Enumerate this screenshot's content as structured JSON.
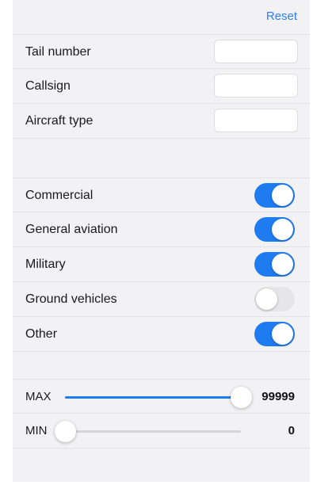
{
  "header": {
    "reset_label": "Reset"
  },
  "fields": [
    {
      "label": "Tail number",
      "value": "",
      "placeholder": ""
    },
    {
      "label": "Callsign",
      "value": "",
      "placeholder": ""
    },
    {
      "label": "Aircraft type",
      "value": "",
      "placeholder": ""
    }
  ],
  "categories": [
    {
      "label": "Commercial",
      "enabled": true
    },
    {
      "label": "General aviation",
      "enabled": true
    },
    {
      "label": "Military",
      "enabled": true
    },
    {
      "label": "Ground vehicles",
      "enabled": false
    },
    {
      "label": "Other",
      "enabled": true
    }
  ],
  "altitude": {
    "max": {
      "label": "MAX",
      "value": "99999",
      "fraction": 1.0
    },
    "min": {
      "label": "MIN",
      "value": "0",
      "fraction": 0.0
    }
  },
  "colors": {
    "accent": "#1f7cf0",
    "toggle_off": "#e6e6ea",
    "background": "#f2f2f5"
  }
}
